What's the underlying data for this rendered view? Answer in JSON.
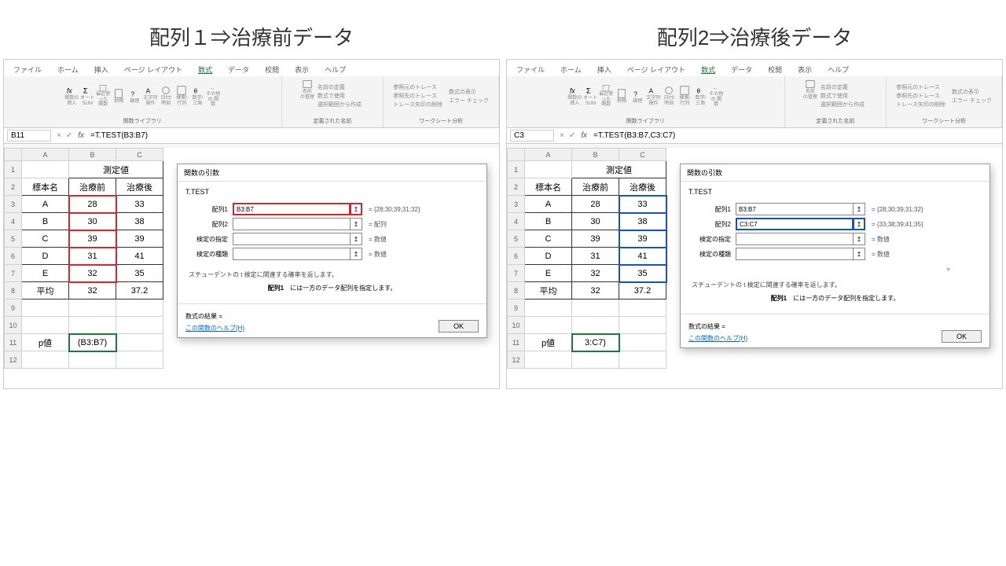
{
  "titles": {
    "left": "配列１⇒治療前データ",
    "right": "配列2⇒治療後データ"
  },
  "tabs": [
    "ファイル",
    "ホーム",
    "挿入",
    "ページ レイアウト",
    "数式",
    "データ",
    "校閲",
    "表示",
    "ヘルプ"
  ],
  "ribbon": {
    "groups": {
      "lib": "関数ライブラリ",
      "names": "定義された名前",
      "audit": "ワークシート分析"
    },
    "icons": {
      "fx": "関数の\n挿入",
      "sum": "オート\nSUM",
      "recent": "最近使った\n関数",
      "fin": "財務",
      "logic": "論理",
      "text": "文字列\n操作",
      "date": "日付/時刻",
      "lookup": "検索/行列",
      "math": "数学/三角",
      "other": "その他の\n関数",
      "name": "名前\nの管理"
    },
    "name_items": [
      "名前の定義",
      "数式で使用",
      "選択範囲から作成"
    ],
    "audit_items": [
      "参照元のトレース",
      "参照先のトレース",
      "トレース矢印の削除"
    ],
    "audit_items2": [
      "数式の表示",
      "エラー チェック"
    ]
  },
  "left": {
    "cellref": "B11",
    "formula": "=T.TEST(B3:B7)",
    "dlg_array1": "B3:B7",
    "dlg_array2": "",
    "dlg_res1": "= {28;30;39;31;32}",
    "dlg_res2": "= 配列",
    "editcell": "(B3:B7)"
  },
  "right": {
    "cellref": "C3",
    "formula": "=T.TEST(B3:B7,C3:C7)",
    "dlg_array1": "B3:B7",
    "dlg_array2": "C3:C7",
    "dlg_res1": "= {28;30;39;31;32}",
    "dlg_res2": "= {33;38;39;41;35}",
    "editcell": "3:C7)"
  },
  "sheet": {
    "header": {
      "col1": "標本名",
      "merged": "測定値",
      "col2": "治療前",
      "col3": "治療後"
    },
    "rows": [
      {
        "name": "A",
        "pre": 28,
        "post": 33
      },
      {
        "name": "B",
        "pre": 30,
        "post": 38
      },
      {
        "name": "C",
        "pre": 39,
        "post": 39
      },
      {
        "name": "D",
        "pre": 31,
        "post": 41
      },
      {
        "name": "E",
        "pre": 32,
        "post": 35
      }
    ],
    "avg": {
      "label": "平均",
      "pre": 32,
      "post": 37.2
    },
    "pval_label": "p値"
  },
  "dialog": {
    "title": "関数の引数",
    "fn": "T.TEST",
    "labels": {
      "a1": "配列1",
      "a2": "配列2",
      "tails": "検定の指定",
      "type": "検定の種類"
    },
    "res_num": "= 数値",
    "desc": "スチューデントの t 検定に関連する確率を返します。",
    "desc2_prefix": "配列1",
    "desc2": "　には一方のデータ配列を指定します。",
    "result": "数式の結果 =",
    "help": "この関数のヘルプ(H)",
    "ok": "OK"
  },
  "chart_data": {
    "type": "table",
    "title": "測定値 (治療前/治療後)",
    "categories": [
      "A",
      "B",
      "C",
      "D",
      "E",
      "平均"
    ],
    "series": [
      {
        "name": "治療前",
        "values": [
          28,
          30,
          39,
          31,
          32,
          32
        ]
      },
      {
        "name": "治療後",
        "values": [
          33,
          38,
          39,
          41,
          35,
          37.2
        ]
      }
    ]
  }
}
